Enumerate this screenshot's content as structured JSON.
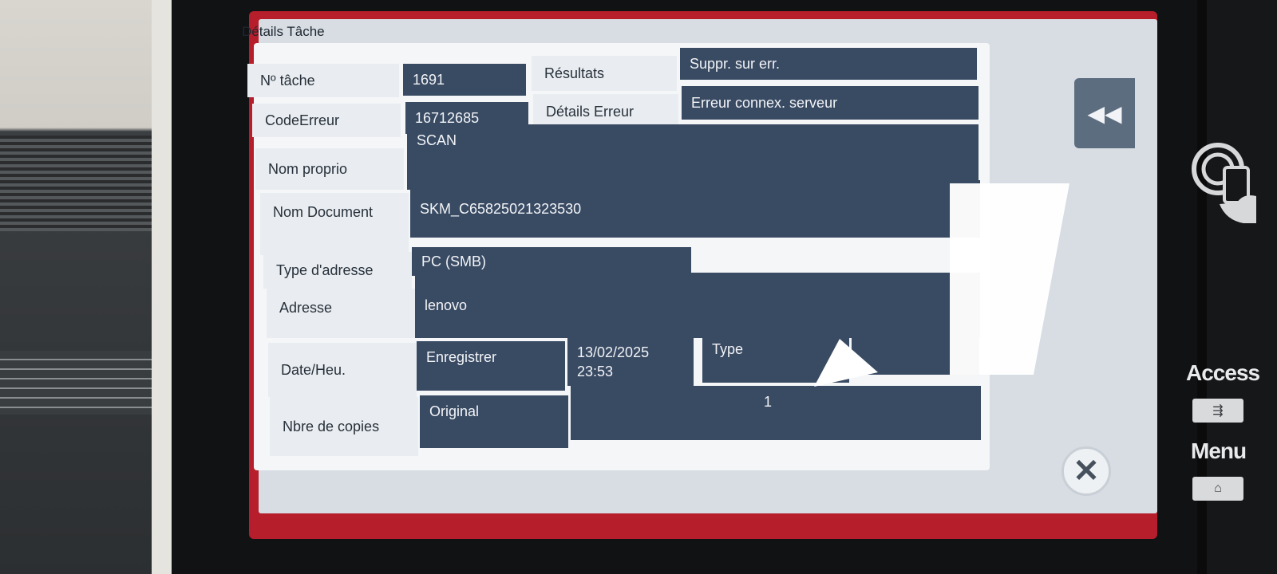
{
  "panel": {
    "title": "Détails Tâche"
  },
  "fields": {
    "job_no": {
      "label": "Nº tâche",
      "value": "1691"
    },
    "results": {
      "label": "Résultats",
      "value": "Suppr. sur err."
    },
    "error_code": {
      "label": "CodeErreur",
      "value": "16712685"
    },
    "error_details": {
      "label": "Détails Erreur",
      "value": "Erreur connex. serveur"
    },
    "owner": {
      "label": "Nom proprio",
      "value": "SCAN"
    },
    "document": {
      "label": "Nom Document",
      "value": "SKM_C65825021323530"
    },
    "address_type": {
      "label": "Type d'adresse",
      "value": "PC (SMB)"
    },
    "address": {
      "label": "Adresse",
      "value": "lenovo"
    },
    "datetime": {
      "label": "Date/Heu.",
      "mode": "Enregistrer",
      "date": "13/02/2025",
      "time": "23:53",
      "type_label": "Type"
    },
    "copies": {
      "label": "Nbre de copies",
      "original_label": "Original",
      "value": "1"
    }
  },
  "controls": {
    "back_icon": "◀◀",
    "close_icon": "✕"
  },
  "hardware": {
    "access_label": "Access",
    "menu_label": "Menu"
  },
  "colors": {
    "value_bg": "#394a63",
    "label_bg": "#e9edf1",
    "frame_red": "#b51e2a"
  }
}
